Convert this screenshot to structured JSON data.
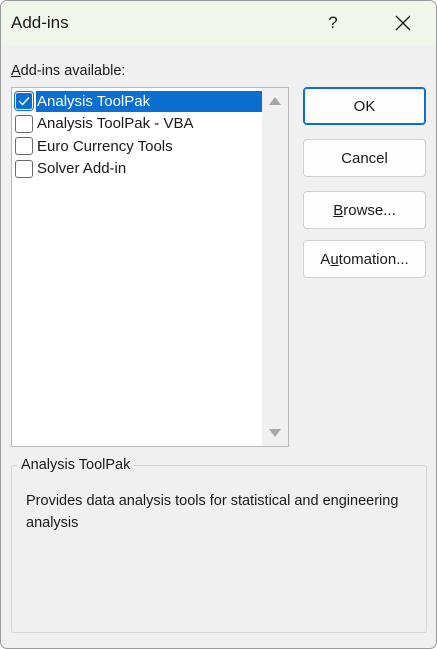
{
  "window": {
    "title": "Add-ins",
    "help_label": "?"
  },
  "list": {
    "label_mnemonic": "A",
    "label_rest": "dd-ins available:",
    "items": [
      {
        "label": "Analysis ToolPak",
        "checked": true,
        "selected": true
      },
      {
        "label": "Analysis ToolPak - VBA",
        "checked": false,
        "selected": false
      },
      {
        "label": "Euro Currency Tools",
        "checked": false,
        "selected": false
      },
      {
        "label": "Solver Add-in",
        "checked": false,
        "selected": false
      }
    ]
  },
  "buttons": {
    "ok": "OK",
    "cancel": "Cancel",
    "browse_mnemonic": "B",
    "browse_rest": "rowse...",
    "automation_pre": "A",
    "automation_mnemonic": "u",
    "automation_rest": "tomation..."
  },
  "description": {
    "title": "Analysis ToolPak",
    "text": "Provides data analysis tools for statistical and engineering analysis"
  },
  "colors": {
    "accent": "#0a6fd1",
    "titlebar": "#f0f7ea",
    "dialog_bg": "#f0f0f0"
  },
  "icons": {
    "close": "close-icon",
    "check": "checkmark-icon",
    "scroll_up": "scroll-up-arrow-icon",
    "scroll_down": "scroll-down-arrow-icon"
  }
}
